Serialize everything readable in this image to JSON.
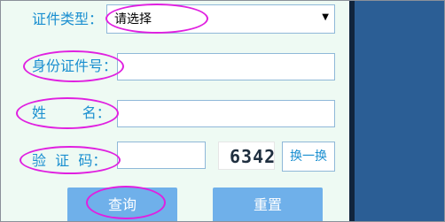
{
  "form": {
    "cert_type_label": "证件类型：",
    "cert_type_value": "请选择",
    "id_number_label": "身份证件号：",
    "name_label": "姓        名：",
    "captcha_label": "验  证  码：",
    "captcha_text": "6342",
    "refresh_label": "换一换"
  },
  "buttons": {
    "query": "查询",
    "reset": "重置"
  },
  "colors": {
    "background": "#eefaf3",
    "label_text": "#1a8fd0",
    "button_bg": "#6fb0ea",
    "highlight_ellipse": "#e020e0",
    "side_panel": "#2b5e95"
  }
}
